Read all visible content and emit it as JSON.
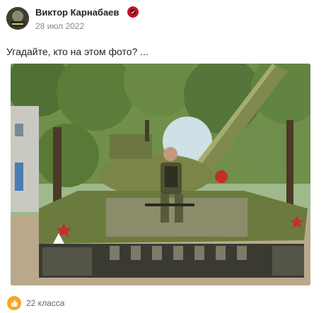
{
  "post": {
    "author": "Виктор Карнабаев",
    "date": "28 июл 2022",
    "text": "Угадайте, кто на этом фото? ...",
    "photo_icon": "tank-photo",
    "likes": "22 класса",
    "like_icon": "thumbs-up-icon",
    "colors": {
      "like_accent": "#f7a823",
      "verified_badge": "#c8102e",
      "date_text": "#8a8a8a"
    }
  }
}
